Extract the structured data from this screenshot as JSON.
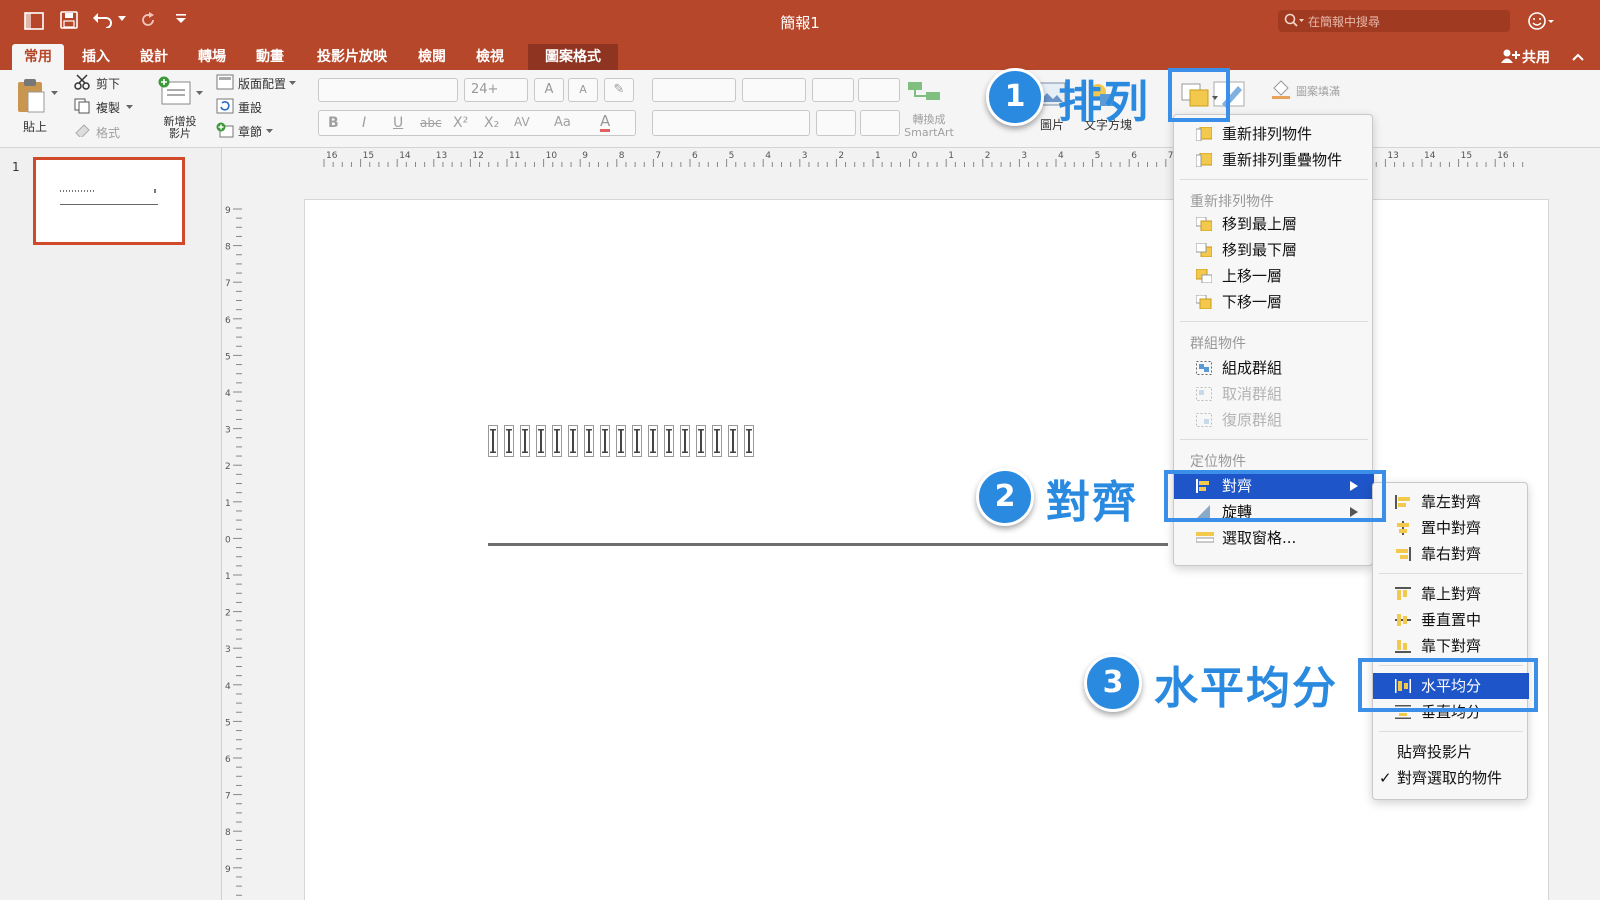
{
  "window": {
    "title": "簡報1",
    "search_placeholder": "在簡報中搜尋"
  },
  "tabs": [
    {
      "label": "常用",
      "active": true
    },
    {
      "label": "插入"
    },
    {
      "label": "設計"
    },
    {
      "label": "轉場"
    },
    {
      "label": "動畫"
    },
    {
      "label": "投影片放映"
    },
    {
      "label": "檢閱"
    },
    {
      "label": "檢視"
    },
    {
      "label": "圖案格式",
      "contextual": true
    }
  ],
  "share_label": "共用",
  "ribbon": {
    "paste": "貼上",
    "cut": "剪下",
    "copy": "複製",
    "format": "格式",
    "new_slide": "新增投影片",
    "layout": "版面配置",
    "reset": "重設",
    "section": "章節",
    "font_size": "24+",
    "convert_smartart_1": "轉換成",
    "convert_smartart_2": "SmartArt",
    "picture": "圖片",
    "shape": "圖形",
    "textbox": "文字方塊",
    "shape_fill": "圖案填滿"
  },
  "thumbnail_number": "1",
  "arrange_menu": {
    "items_top": [
      "重新排列物件",
      "重新排列重疊物件"
    ],
    "header_reorder": "重新排列物件",
    "reorder": [
      "移到最上層",
      "移到最下層",
      "上移一層",
      "下移一層"
    ],
    "header_group": "群組物件",
    "group": [
      "組成群組",
      "取消群組",
      "復原群組"
    ],
    "header_position": "定位物件",
    "align": "對齊",
    "rotate": "旋轉",
    "selection_pane": "選取窗格..."
  },
  "align_menu": {
    "horizontal": [
      "靠左對齊",
      "置中對齊",
      "靠右對齊"
    ],
    "vertical": [
      "靠上對齊",
      "垂直置中",
      "靠下對齊"
    ],
    "distribute_h": "水平均分",
    "distribute_v": "垂直均分",
    "snap_slide": "貼齊投影片",
    "align_selected": "對齊選取的物件",
    "align_selected_check": "✓"
  },
  "annotations": [
    {
      "number": "1",
      "label": "排列"
    },
    {
      "number": "2",
      "label": "對齊"
    },
    {
      "number": "3",
      "label": "水平均分"
    }
  ],
  "colors": {
    "accent": "#b7472a",
    "annotation": "#2a8ae0",
    "menu_highlight": "#1e55c8"
  },
  "ruler": {
    "horizontal_ticks": [
      "16",
      "15",
      "14",
      "13",
      "12",
      "11",
      "10",
      "9",
      "8",
      "7",
      "6",
      "5",
      "4",
      "3",
      "2",
      "1",
      "0",
      "1",
      "2",
      "3",
      "4",
      "5",
      "6",
      "7",
      "8",
      "9",
      "10",
      "11",
      "12",
      "13",
      "14",
      "15",
      "16"
    ],
    "vertical_ticks": [
      "9",
      "8",
      "7",
      "6",
      "5",
      "4",
      "3",
      "2",
      "1",
      "0",
      "1",
      "2",
      "3",
      "4",
      "5",
      "6",
      "7",
      "8",
      "9"
    ]
  }
}
